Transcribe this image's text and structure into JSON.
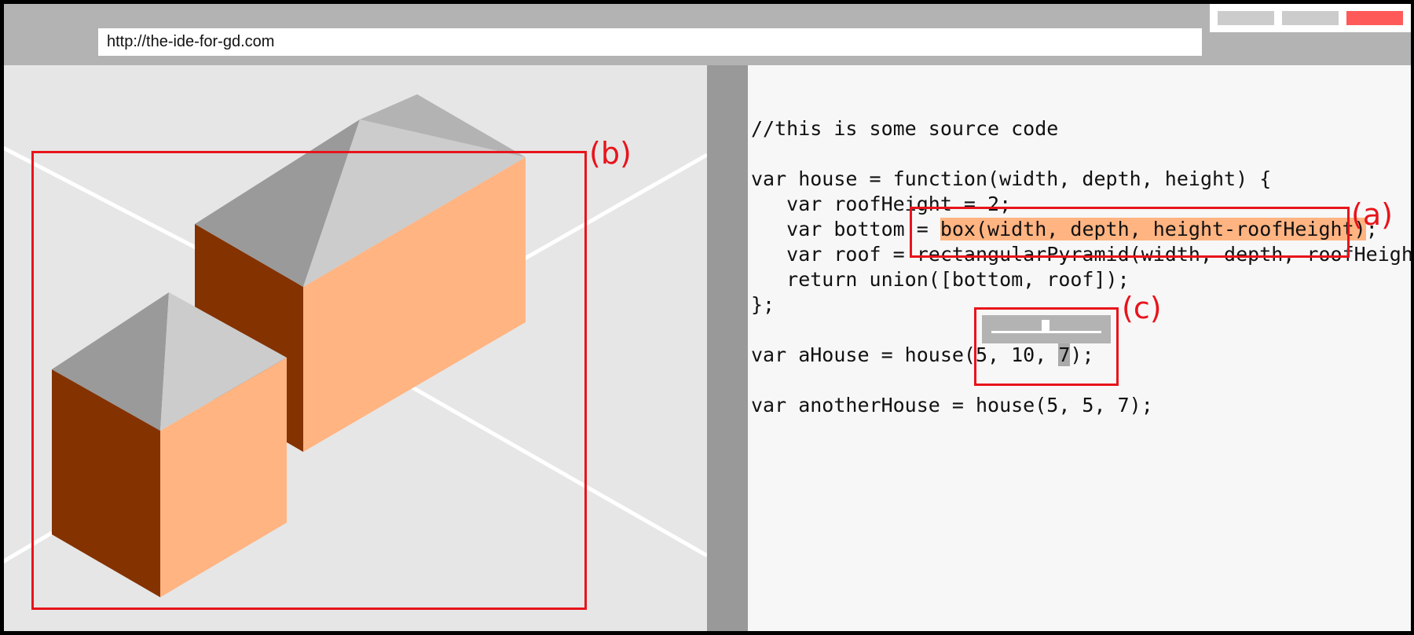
{
  "browser": {
    "url": "http://the-ide-for-gd.com",
    "window_controls": [
      "minimize-button",
      "maximize-button",
      "close-button"
    ]
  },
  "annotations": {
    "a": "(a)",
    "b": "(b)",
    "c": "(c)"
  },
  "code": {
    "line1": "//this is some source code",
    "line3": "var house = function(width, depth, height) {",
    "line4": "   var roofHeight = 2;",
    "line5_pre": "   var bottom = ",
    "line5_hl": "box(width, depth, height-roofHeight)",
    "line5_post": ";",
    "line6": "   var roof = rectangularPyramid(width, depth, roofHeight);",
    "line7": "   return union([bottom, roof]);",
    "line8": "};",
    "line10_pre": "var aHouse = house(5, 10, ",
    "line10_hl": "7",
    "line10_post": ");",
    "line12": "var anotherHouse = house(5, 5, 7);"
  },
  "slider": {
    "value": 7
  },
  "colors": {
    "highlight": "#ffb482",
    "annotation_red": "#e8141b",
    "house_front": "#ffb482",
    "house_side": "#843200",
    "roof_light": "#cccccc",
    "roof_dark": "#9a9a9a"
  }
}
